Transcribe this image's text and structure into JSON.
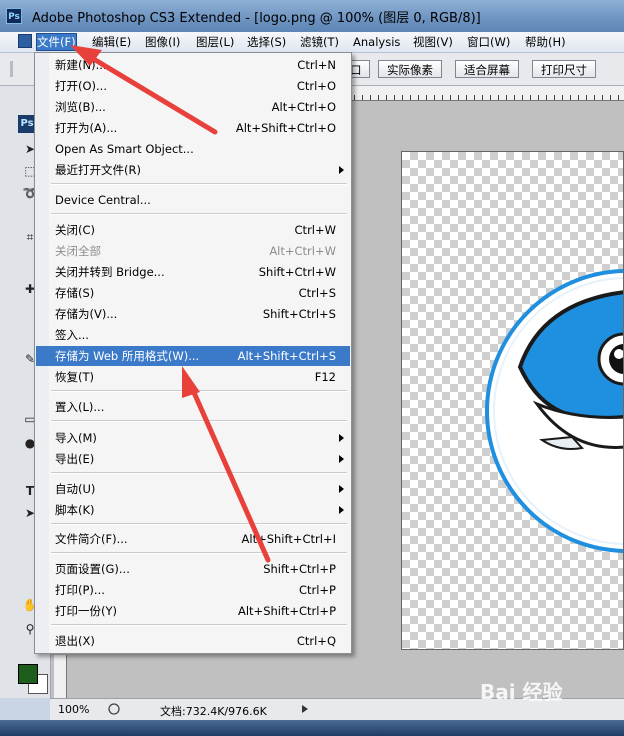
{
  "window": {
    "title": "Adobe Photoshop CS3 Extended - [logo.png @ 100% (图层 0, RGB/8)]",
    "app_icon": "Ps"
  },
  "menubar": {
    "items": [
      "文件(F)",
      "编辑(E)",
      "图像(I)",
      "图层(L)",
      "选择(S)",
      "滤镜(T)",
      "Analysis",
      "视图(V)",
      "窗口(W)",
      "帮助(H)"
    ],
    "active_index": 0
  },
  "options_bar": {
    "buttons": [
      "实际像素",
      "适合屏幕",
      "打印尺寸"
    ],
    "partial_button": "口"
  },
  "toolbox": {
    "ps_label": "Ps",
    "type_tool": "T"
  },
  "file_menu": {
    "items": [
      {
        "label": "新建(N)...",
        "shortcut": "Ctrl+N"
      },
      {
        "label": "打开(O)...",
        "shortcut": "Ctrl+O"
      },
      {
        "label": "浏览(B)...",
        "shortcut": "Alt+Ctrl+O"
      },
      {
        "label": "打开为(A)...",
        "shortcut": "Alt+Shift+Ctrl+O"
      },
      {
        "label": "Open As Smart Object..."
      },
      {
        "label": "最近打开文件(R)",
        "submenu": true
      },
      {
        "label": "Device Central..."
      },
      {
        "label": "关闭(C)",
        "shortcut": "Ctrl+W"
      },
      {
        "label": "关闭全部",
        "shortcut": "Alt+Ctrl+W",
        "disabled": true
      },
      {
        "label": "关闭并转到 Bridge...",
        "shortcut": "Shift+Ctrl+W"
      },
      {
        "label": "存储(S)",
        "shortcut": "Ctrl+S"
      },
      {
        "label": "存储为(V)...",
        "shortcut": "Shift+Ctrl+S"
      },
      {
        "label": "签入..."
      },
      {
        "label": "存储为 Web 所用格式(W)...",
        "shortcut": "Alt+Shift+Ctrl+S",
        "highlighted": true
      },
      {
        "label": "恢复(T)",
        "shortcut": "F12"
      },
      {
        "label": "置入(L)..."
      },
      {
        "label": "导入(M)",
        "submenu": true
      },
      {
        "label": "导出(E)",
        "submenu": true
      },
      {
        "label": "自动(U)",
        "submenu": true
      },
      {
        "label": "脚本(K)",
        "submenu": true
      },
      {
        "label": "文件简介(F)...",
        "shortcut": "Alt+Shift+Ctrl+I"
      },
      {
        "label": "页面设置(G)...",
        "shortcut": "Shift+Ctrl+P"
      },
      {
        "label": "打印(P)...",
        "shortcut": "Ctrl+P"
      },
      {
        "label": "打印一份(Y)",
        "shortcut": "Alt+Shift+Ctrl+P"
      },
      {
        "label": "退出(X)",
        "shortcut": "Ctrl+Q"
      }
    ]
  },
  "status_bar": {
    "zoom": "100%",
    "doc_info": "文档:732.4K/976.6K"
  },
  "watermark": "Bai 经验",
  "colors": {
    "highlight": "#3b79c9",
    "arrow": "#e8403a",
    "logo_blue": "#1f8fe0",
    "foreground_swatch": "#1d5e1d"
  }
}
